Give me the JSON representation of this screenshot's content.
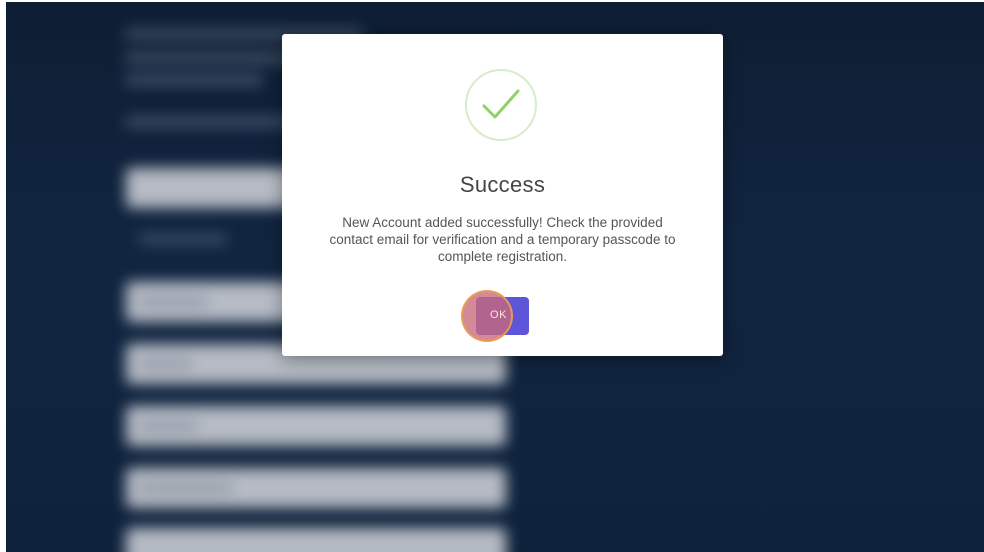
{
  "dialog": {
    "title": "Success",
    "message": "New Account added successfully! Check the provided contact email for verification and a temporary passcode to complete registration.",
    "ok_label": "OK",
    "icon": "checkmark-circle-icon"
  },
  "colors": {
    "background": "#112541",
    "accent": "#5f55d8",
    "success_check": "#8fd16a",
    "click_highlight": "#e89a55"
  }
}
